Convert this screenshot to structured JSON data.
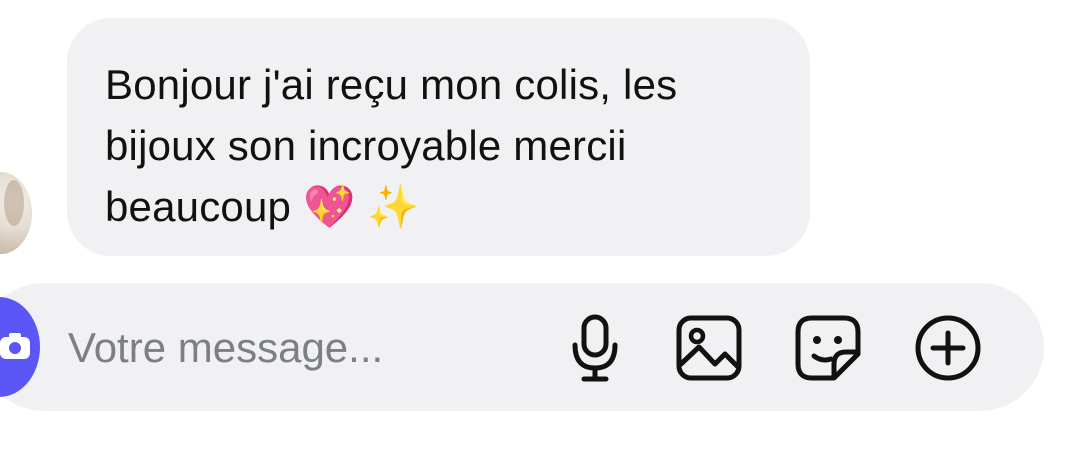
{
  "conversation": {
    "received_message": {
      "text": "Bonjour j'ai reçu mon colis, les bijoux son incroyable mercii beaucoup 💖 ✨"
    }
  },
  "composer": {
    "placeholder": "Votre message...",
    "tools": [
      {
        "icon": "microphone-icon"
      },
      {
        "icon": "image-icon"
      },
      {
        "icon": "sticker-icon"
      },
      {
        "icon": "plus-circle-icon"
      }
    ]
  },
  "colors": {
    "bubble_background": "#f1f1f3",
    "composer_background": "#f1f1f3",
    "camera_button": "#5b57f6",
    "text": "#111111",
    "placeholder": "#7b7f86",
    "icon_stroke": "#111111"
  }
}
